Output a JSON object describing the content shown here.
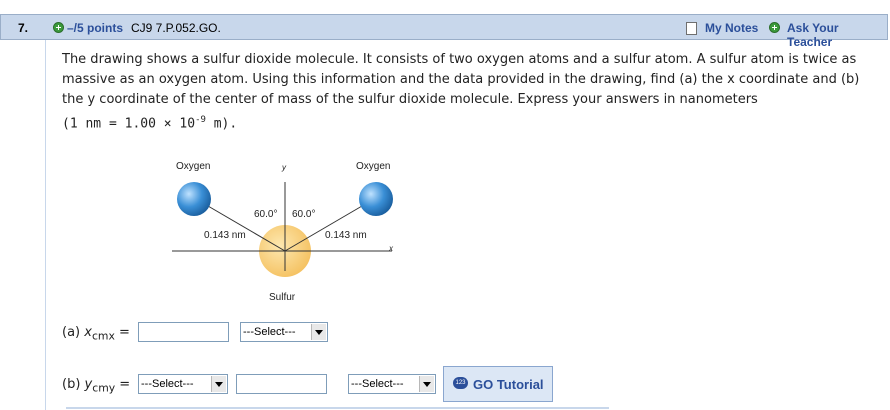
{
  "header": {
    "question_number": "7.",
    "points": "–/5 points",
    "question_id": "CJ9 7.P.052.GO.",
    "my_notes": "My Notes",
    "ask_teacher": "Ask Your Teacher"
  },
  "problem": {
    "text": "The drawing shows a sulfur dioxide molecule. It consists of two oxygen atoms and a sulfur atom. A sulfur atom is twice as massive as an oxygen atom. Using this information and the data provided in the drawing, find (a) the x coordinate and (b) the y coordinate of the center of mass of the sulfur dioxide molecule. Express your answers in nanometers",
    "units_prefix": "(1 nm = 1.00 × 10",
    "units_exp": "-9",
    "units_suffix": " m)."
  },
  "figure": {
    "oxygen_left": "Oxygen",
    "oxygen_right": "Oxygen",
    "y_axis": "y",
    "x_axis": "x",
    "angle_left": "60.0°",
    "angle_right": "60.0°",
    "dist_left": "0.143 nm",
    "dist_right": "0.143 nm",
    "sulfur": "Sulfur",
    "colors": {
      "oxygen": "#3a8fd6",
      "sulfur": "#f7c969"
    }
  },
  "part_a": {
    "label_prefix": "(a) ",
    "var": "x",
    "sub": "cmx",
    "eq": " =",
    "value": "",
    "unit_select": "---Select---"
  },
  "part_b": {
    "label_prefix": "(b) ",
    "var": "y",
    "sub": "cmy",
    "eq": " =",
    "sign_select": "---Select---",
    "value": "",
    "unit_select": "---Select---"
  },
  "tutorial": {
    "icon": "123",
    "label": "GO Tutorial"
  }
}
